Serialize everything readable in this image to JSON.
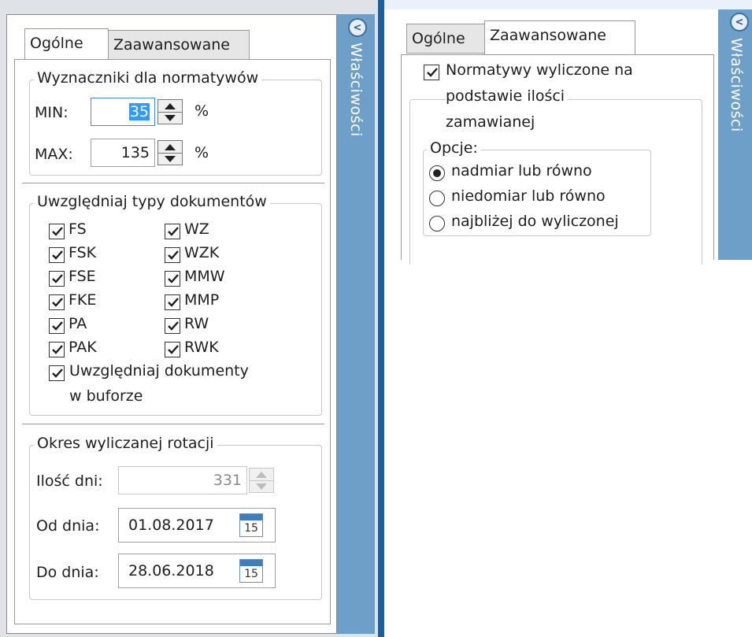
{
  "left": {
    "tabs": [
      "Ogólne",
      "Zaawansowane"
    ],
    "side_label": "Właściwości",
    "wyznaczniki": {
      "title": "Wyznaczniki dla normatywów",
      "min_label": "MIN:",
      "min_value": "35",
      "max_label": "MAX:",
      "max_value": "135",
      "unit": "%"
    },
    "typy": {
      "title": "Uwzględniaj typy dokumentów",
      "col1": [
        "FS",
        "FSK",
        "FSE",
        "FKE",
        "PA",
        "PAK"
      ],
      "col2": [
        "WZ",
        "WZK",
        "MMW",
        "MMP",
        "RW",
        "RWK"
      ],
      "bufor_line1": "Uwzględniaj dokumenty",
      "bufor_line2": "w buforze"
    },
    "okres": {
      "title": "Okres wyliczanej rotacji",
      "ilosc_label": "Ilość dni:",
      "ilosc_value": "331",
      "od_label": "Od dnia:",
      "od_value": "01.08.2017",
      "do_label": "Do dnia:",
      "do_value": "28.06.2018",
      "calendar_day": "15"
    }
  },
  "right": {
    "tabs": [
      "Ogólne",
      "Zaawansowane"
    ],
    "side_label": "Właściwości",
    "normatywy_line1": "Normatywy wyliczone na",
    "normatywy_line2": "podstawie ilości",
    "normatywy_line3": "zamawianej",
    "opcje_title": "Opcje:",
    "options": [
      "nadmiar lub równo",
      "niedomiar lub równo",
      "najbliżej do wyliczonej"
    ],
    "selected_option": 0
  },
  "icons": {
    "collapse": "chevron-left-icon",
    "check": "checkmark-icon",
    "calendar": "calendar-icon"
  },
  "colors": {
    "sidebar": "#6e9fc9",
    "divider": "#1d5f9e",
    "selection": "#3399ff"
  }
}
